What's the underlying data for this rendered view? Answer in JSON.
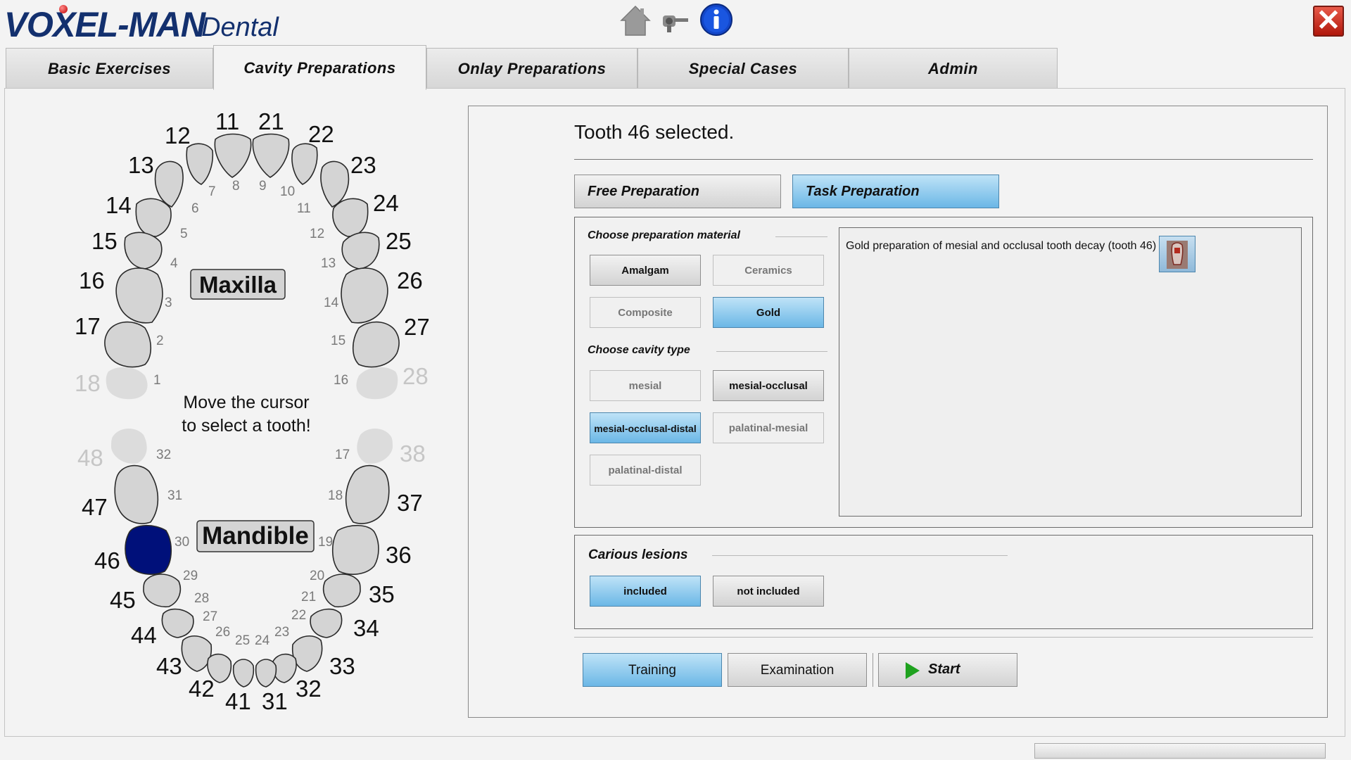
{
  "app": {
    "logo_main": "VOXEL-MAN",
    "logo_sub": "Dental",
    "toolbar_icons": [
      "home-icon",
      "drill-icon",
      "info-icon"
    ],
    "close_label": "✕"
  },
  "tabs": [
    {
      "label": "Basic Exercises"
    },
    {
      "label": "Cavity Preparations",
      "active": true
    },
    {
      "label": "Onlay Preparations"
    },
    {
      "label": "Special Cases"
    },
    {
      "label": "Admin"
    }
  ],
  "chart": {
    "maxilla_label": "Maxilla",
    "mandible_label": "Mandible",
    "instruction_line1": "Move the cursor",
    "instruction_line2": "to select a tooth!",
    "selected_tooth": "46",
    "selected_color": "#00107a",
    "upper_teeth": [
      "11",
      "21",
      "12",
      "22",
      "13",
      "23",
      "14",
      "24",
      "15",
      "25",
      "16",
      "26",
      "17",
      "27",
      "18",
      "28"
    ],
    "lower_teeth": [
      "41",
      "31",
      "42",
      "32",
      "43",
      "33",
      "44",
      "34",
      "45",
      "35",
      "46",
      "36",
      "47",
      "37",
      "48",
      "38"
    ],
    "small_indices": [
      "1",
      "2",
      "3",
      "4",
      "5",
      "6",
      "7",
      "8",
      "9",
      "10",
      "11",
      "12",
      "13",
      "14",
      "15",
      "16",
      "17",
      "18",
      "19",
      "20",
      "21",
      "22",
      "23",
      "24",
      "25",
      "26",
      "27",
      "28",
      "29",
      "30",
      "31",
      "32"
    ]
  },
  "panel": {
    "status": "Tooth 46 selected.",
    "free_preparation": "Free Preparation",
    "task_preparation": "Task Preparation",
    "material": {
      "title": "Choose preparation material",
      "options": [
        "Amalgam",
        "Ceramics",
        "Composite",
        "Gold"
      ],
      "selected": "Gold"
    },
    "cavity": {
      "title": "Choose cavity type",
      "options": [
        "mesial",
        "mesial-occlusal",
        "mesial-occlusal-distal",
        "palatinal-mesial",
        "palatinal-distal"
      ],
      "selected": "mesial-occlusal-distal"
    },
    "task_description": "Gold preparation of mesial and occlusal tooth decay (tooth 46)",
    "carious": {
      "title": "Carious lesions",
      "options": [
        "included",
        "not included"
      ],
      "selected": "included"
    },
    "mode_training": "Training",
    "mode_examination": "Examination",
    "start": "Start"
  }
}
